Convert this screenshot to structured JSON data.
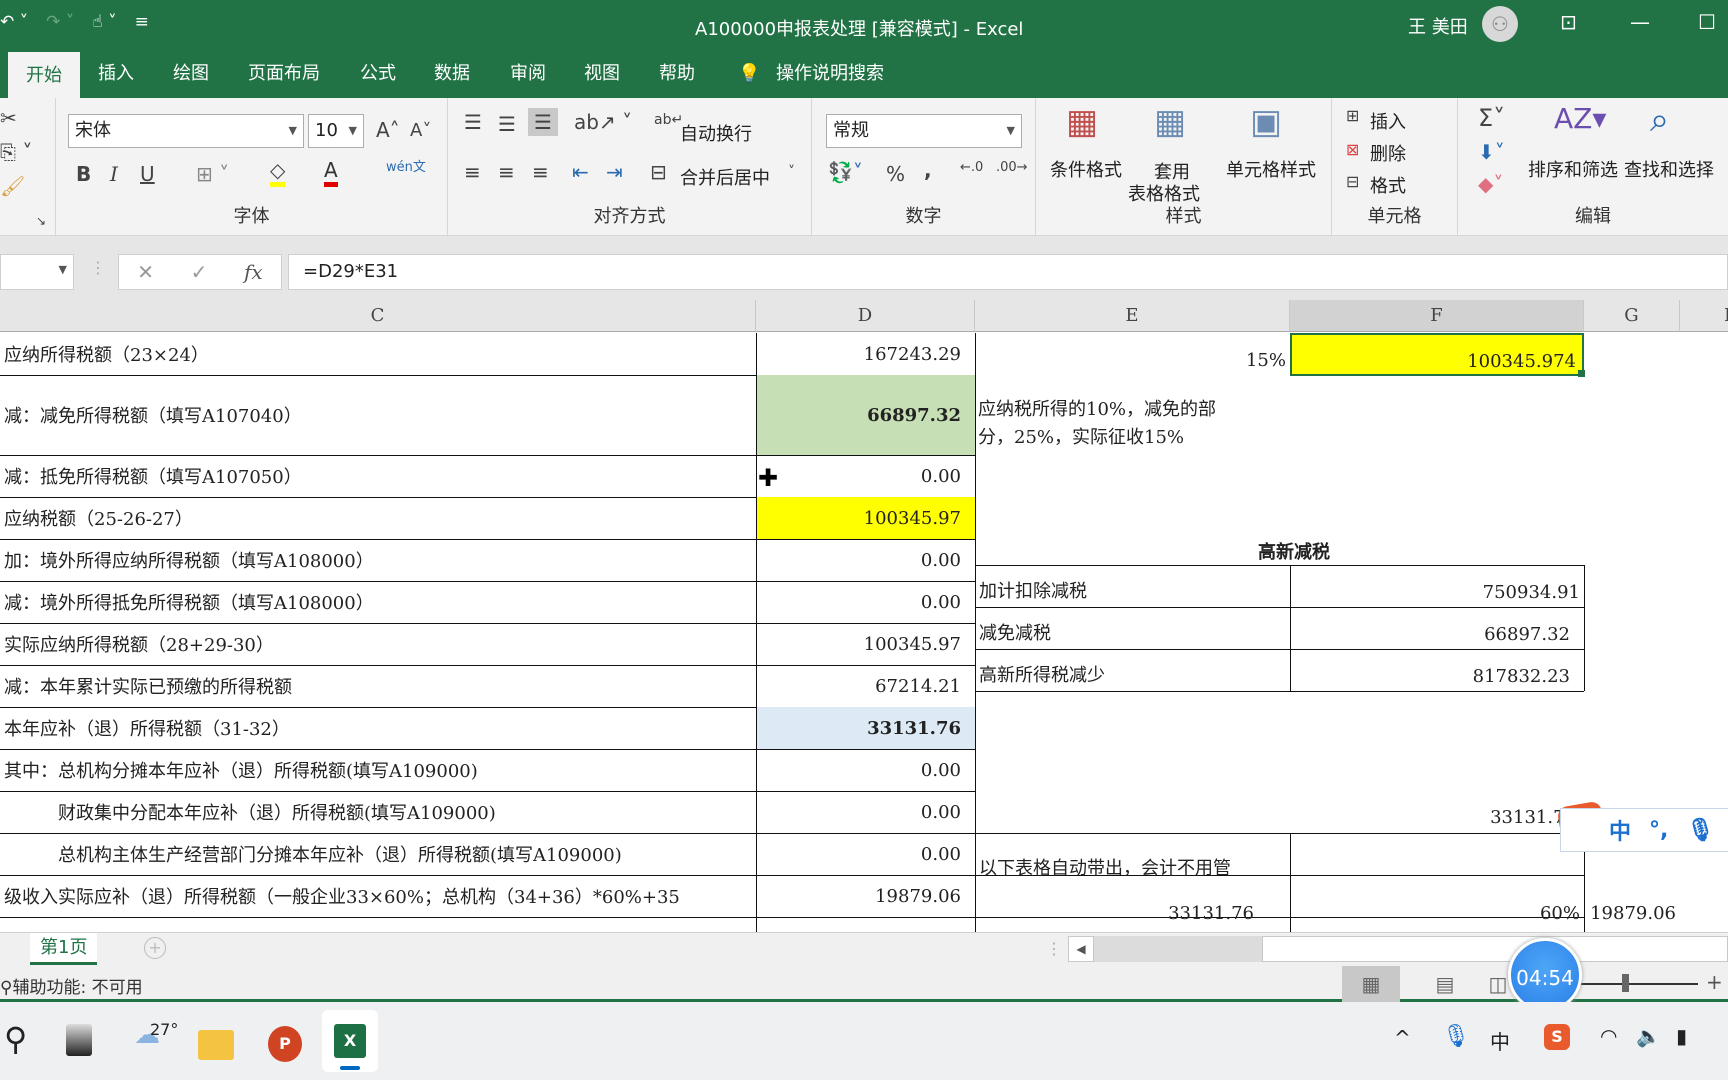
{
  "window": {
    "title": "A100000申报表处理  [兼容模式]  -  Excel",
    "user": "王 美田",
    "qat": [
      "undo-icon",
      "redo-icon",
      "touch-mode-icon",
      "customize-qat-icon"
    ]
  },
  "tabs": [
    "开始",
    "插入",
    "绘图",
    "页面布局",
    "公式",
    "数据",
    "审阅",
    "视图",
    "帮助"
  ],
  "tell_me": "操作说明搜索",
  "ribbon": {
    "font": {
      "name": "宋体",
      "size": "10",
      "label": "字体",
      "bold": "B",
      "italic": "I",
      "underline": "U",
      "phonetic": "wén文"
    },
    "alignment": {
      "wrap": "自动换行",
      "merge": "合并后居中",
      "label": "对齐方式"
    },
    "number": {
      "format": "常规",
      "label": "数字",
      "percent": "%",
      "comma": ","
    },
    "styles": {
      "conditional": "条件格式",
      "table_line1": "套用",
      "table_line2": "表格格式",
      "cell_styles": "单元格样式",
      "label": "样式"
    },
    "cells": {
      "insert": "插入",
      "delete": "删除",
      "format": "格式",
      "label": "单元格"
    },
    "editing": {
      "sort": "排序和筛选",
      "find": "查找和选择",
      "label": "编辑"
    }
  },
  "formula_bar": {
    "name_box": "",
    "formula": "=D29*E31",
    "fx": "fx"
  },
  "columns": [
    "C",
    "D",
    "E",
    "F",
    "G",
    "H"
  ],
  "rows": [
    {
      "label": "应纳所得税额（23×24）",
      "value": "167243.29"
    },
    {
      "label": "减：减免所得税额（填写A107040）",
      "value": "66897.32"
    },
    {
      "label": "减：抵免所得税额（填写A107050）",
      "value": "0.00"
    },
    {
      "label": "应纳税额（25-26-27）",
      "value": "100345.97"
    },
    {
      "label": "加：境外所得应纳所得税额（填写A108000）",
      "value": "0.00"
    },
    {
      "label": "减：境外所得抵免所得税额（填写A108000）",
      "value": "0.00"
    },
    {
      "label": "实际应纳所得税额（28+29-30）",
      "value": "100345.97"
    },
    {
      "label": "减：本年累计实际已预缴的所得税额",
      "value": "67214.21"
    },
    {
      "label": "本年应补（退）所得税额（31-32）",
      "value": "33131.76"
    },
    {
      "label": "其中：总机构分摊本年应补（退）所得税额(填写A109000)",
      "value": "0.00"
    },
    {
      "label": "　　　财政集中分配本年应补（退）所得税额(填写A109000)",
      "value": "0.00"
    },
    {
      "label": "　　　总机构主体生产经营部门分摊本年应补（退）所得税额(填写A109000)",
      "value": "0.00"
    },
    {
      "label": "级收入实际应补（退）所得税额（一般企业33×60%；总机构（34+36）*60%+35",
      "value": "19879.06"
    }
  ],
  "side": {
    "rate": "15%",
    "f_value": "100345.974",
    "note": "应纳税所得的10%，减免的部分，25%，实际征收15%",
    "note_line1": "应纳税所得的10%，减免的部",
    "note_line2": "分，25%，实际征收15%",
    "gx_title": "高新减税",
    "gx_rows": [
      {
        "label": "加计扣除减税",
        "value": "750934.91"
      },
      {
        "label": "减免减税",
        "value": "66897.32"
      },
      {
        "label": "高新所得税减少",
        "value": "817832.23"
      }
    ],
    "f_33131": "33131.76",
    "auto_note": "以下表格自动带出，会计不用管",
    "bottom_e": "33131.76",
    "bottom_f": "60%",
    "bottom_g": "19879.06"
  },
  "sheet_tab": "第1页",
  "status": {
    "accessibility": "辅助功能: 不可用"
  },
  "timer": "04:54",
  "ime": {
    "mode": "中",
    "punct": "°,"
  },
  "taskbar": {
    "weather": "27°",
    "ime_indicator": "中"
  },
  "colors": {
    "accent": "#217346",
    "yellow": "#ffff00",
    "green_cell": "#c6dfb4",
    "blue_cell": "#dde9f4"
  }
}
